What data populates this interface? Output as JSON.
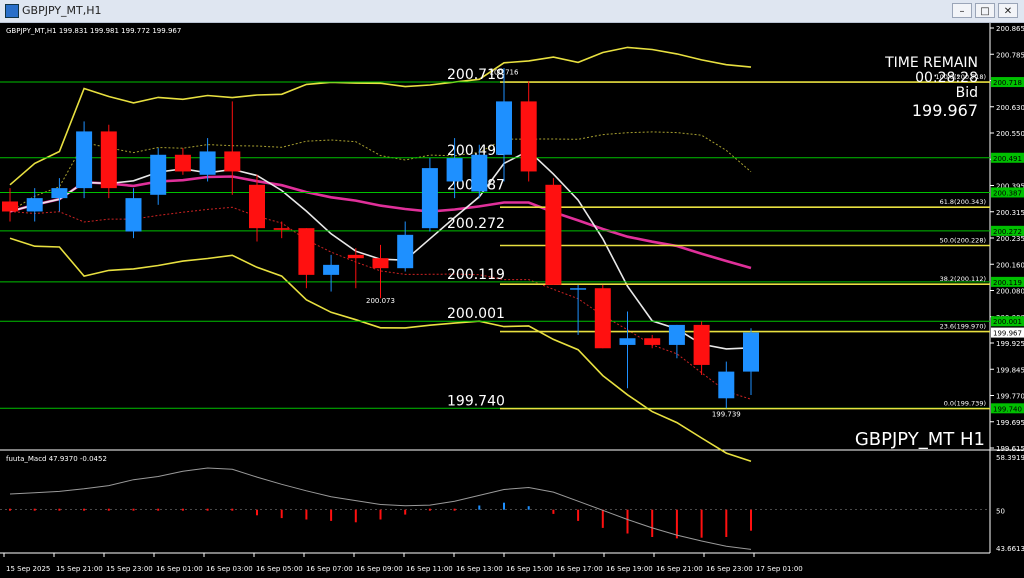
{
  "window": {
    "title": "GBPJPY_MT,H1",
    "controls": [
      "–",
      "□",
      "✕"
    ],
    "icons": {
      "app": "chart-window-icon",
      "minimize": "minimize-icon",
      "maximize": "maximize-icon",
      "close": "close-icon"
    }
  },
  "header": {
    "symbol_info": "GBPJPY_MT,H1  199.831 199.981 199.772 199.967",
    "time_remain_label": "TIME REMAIN",
    "time_remain_value": "00:28:28",
    "bid_label": "Bid",
    "bid_value": "199.967",
    "watermark": "GBPJPY_MT H1"
  },
  "indicator_label": "fuuta_Macd 47.9370 -0.0452",
  "colors": {
    "background": "#000000",
    "bull": "#1e90ff",
    "bear": "#ff1010",
    "level_line": "#00c000",
    "bollinger": "#e8e040",
    "ma_pink": "#e0309a",
    "ma_white": "#e8e8e8",
    "fibo": "#e8e040",
    "dotted_red": "#cc2222",
    "dotted_yellow": "#a8a030",
    "axis_text": "#ffffff"
  },
  "chart_data": {
    "type": "candlestick",
    "ylim": [
      199.615,
      200.895
    ],
    "price_axis_ticks": [
      "200.865",
      "200.785",
      "200.705",
      "200.630",
      "200.550",
      "200.470",
      "200.395",
      "200.315",
      "200.235",
      "200.160",
      "200.080",
      "200.000",
      "199.925",
      "199.845",
      "199.770",
      "199.695",
      "199.615"
    ],
    "time_labels": [
      "15 Sep 2025",
      "15 Sep 21:00",
      "15 Sep 23:00",
      "16 Sep 01:00",
      "16 Sep 03:00",
      "16 Sep 05:00",
      "16 Sep 07:00",
      "16 Sep 09:00",
      "16 Sep 11:00",
      "16 Sep 13:00",
      "16 Sep 15:00",
      "16 Sep 17:00",
      "16 Sep 19:00",
      "16 Sep 21:00",
      "16 Sep 23:00",
      "17 Sep 01:00"
    ],
    "candles": [
      {
        "o": 200.36,
        "h": 200.4,
        "l": 200.3,
        "c": 200.33
      },
      {
        "o": 200.33,
        "h": 200.4,
        "l": 200.3,
        "c": 200.37
      },
      {
        "o": 200.37,
        "h": 200.43,
        "l": 200.33,
        "c": 200.4
      },
      {
        "o": 200.4,
        "h": 200.6,
        "l": 200.37,
        "c": 200.57
      },
      {
        "o": 200.57,
        "h": 200.59,
        "l": 200.37,
        "c": 200.4
      },
      {
        "o": 200.27,
        "h": 200.4,
        "l": 200.25,
        "c": 200.37
      },
      {
        "o": 200.38,
        "h": 200.52,
        "l": 200.35,
        "c": 200.5
      },
      {
        "o": 200.5,
        "h": 200.52,
        "l": 200.44,
        "c": 200.45
      },
      {
        "o": 200.44,
        "h": 200.55,
        "l": 200.42,
        "c": 200.51
      },
      {
        "o": 200.51,
        "h": 200.66,
        "l": 200.38,
        "c": 200.45
      },
      {
        "o": 200.41,
        "h": 200.44,
        "l": 200.24,
        "c": 200.28
      },
      {
        "o": 200.28,
        "h": 200.3,
        "l": 200.25,
        "c": 200.275
      },
      {
        "o": 200.28,
        "h": 200.28,
        "l": 200.1,
        "c": 200.14
      },
      {
        "o": 200.14,
        "h": 200.2,
        "l": 200.09,
        "c": 200.17
      },
      {
        "o": 200.2,
        "h": 200.22,
        "l": 200.1,
        "c": 200.19
      },
      {
        "o": 200.19,
        "h": 200.23,
        "l": 200.07,
        "c": 200.16
      },
      {
        "o": 200.16,
        "h": 200.3,
        "l": 200.15,
        "c": 200.26
      },
      {
        "o": 200.28,
        "h": 200.49,
        "l": 200.27,
        "c": 200.46
      },
      {
        "o": 200.42,
        "h": 200.55,
        "l": 200.37,
        "c": 200.49
      },
      {
        "o": 200.39,
        "h": 200.53,
        "l": 200.37,
        "c": 200.5
      },
      {
        "o": 200.5,
        "h": 200.76,
        "l": 200.42,
        "c": 200.66
      },
      {
        "o": 200.66,
        "h": 200.72,
        "l": 200.42,
        "c": 200.45
      },
      {
        "o": 200.41,
        "h": 200.43,
        "l": 200.11,
        "c": 200.11
      },
      {
        "o": 200.1,
        "h": 200.11,
        "l": 199.96,
        "c": 200.1
      },
      {
        "o": 200.1,
        "h": 200.11,
        "l": 199.92,
        "c": 199.92
      },
      {
        "o": 199.93,
        "h": 200.03,
        "l": 199.8,
        "c": 199.95
      },
      {
        "o": 199.95,
        "h": 199.96,
        "l": 199.92,
        "c": 199.93
      },
      {
        "o": 199.93,
        "h": 199.99,
        "l": 199.89,
        "c": 199.99
      },
      {
        "o": 199.99,
        "h": 200.0,
        "l": 199.84,
        "c": 199.87
      },
      {
        "o": 199.77,
        "h": 199.88,
        "l": 199.74,
        "c": 199.85
      },
      {
        "o": 199.85,
        "h": 199.98,
        "l": 199.78,
        "c": 199.967
      }
    ],
    "horizontal_levels": [
      {
        "value": 200.718,
        "label": "200.718"
      },
      {
        "value": 200.491,
        "label": "200.491"
      },
      {
        "value": 200.387,
        "label": "200.387"
      },
      {
        "value": 200.272,
        "label": "200.272"
      },
      {
        "value": 200.119,
        "label": "200.119"
      },
      {
        "value": 200.001,
        "label": "200.001"
      },
      {
        "value": 199.74,
        "label": "199.740"
      }
    ],
    "right_axis_badges": [
      {
        "value": 200.718,
        "label": "200.718",
        "color": "#00c000"
      },
      {
        "value": 200.491,
        "label": "200.491",
        "color": "#00c000"
      },
      {
        "value": 200.387,
        "label": "200.387",
        "color": "#00c000"
      },
      {
        "value": 200.272,
        "label": "200.272",
        "color": "#00c000"
      },
      {
        "value": 200.119,
        "label": "200.119",
        "color": "#00c000"
      },
      {
        "value": 200.001,
        "label": "200.001",
        "color": "#00c000"
      },
      {
        "value": 199.967,
        "label": "199.967",
        "color": "#ffffff"
      },
      {
        "value": 199.74,
        "label": "199.740",
        "color": "#00c000"
      }
    ],
    "fibo_levels": [
      {
        "value": 200.718,
        "label": "100.0(200.718)"
      },
      {
        "value": 200.343,
        "label": "61.8(200.343)"
      },
      {
        "value": 200.228,
        "label": "50.0(200.228)"
      },
      {
        "value": 200.112,
        "label": "38.2(200.112)"
      },
      {
        "value": 199.97,
        "label": "23.6(199.970)"
      },
      {
        "value": 199.739,
        "label": "0.0(199.739)"
      }
    ],
    "point_labels": [
      {
        "candle": 20,
        "value": 200.74,
        "label": "200.716"
      },
      {
        "candle": 15,
        "value": 200.055,
        "label": "200.073"
      },
      {
        "candle": 29,
        "value": 199.715,
        "label": "199.739"
      }
    ],
    "macd": {
      "ylim": [
        43.6613,
        58.3919
      ],
      "ticks": [
        "58.3919",
        "50",
        "43.6613"
      ],
      "histogram": [
        0,
        0,
        0,
        0,
        0,
        0,
        0,
        0,
        0,
        0,
        -0.8,
        -1.2,
        -1.4,
        -1.6,
        -1.8,
        -1.4,
        -0.7,
        0,
        0,
        0.6,
        1.0,
        0.5,
        -0.6,
        -1.6,
        -2.6,
        -3.4,
        -3.9,
        -4.1,
        -4.0,
        -3.9,
        -3.0
      ],
      "signal": [
        52.4,
        52.6,
        52.8,
        53.2,
        53.7,
        54.6,
        55.1,
        55.9,
        56.4,
        56.2,
        55.0,
        53.9,
        52.9,
        52.0,
        51.4,
        50.8,
        50.6,
        50.7,
        51.3,
        52.2,
        53.1,
        53.4,
        52.7,
        51.3,
        49.9,
        48.5,
        47.2,
        46.1,
        45.2,
        44.4,
        43.9
      ]
    }
  }
}
